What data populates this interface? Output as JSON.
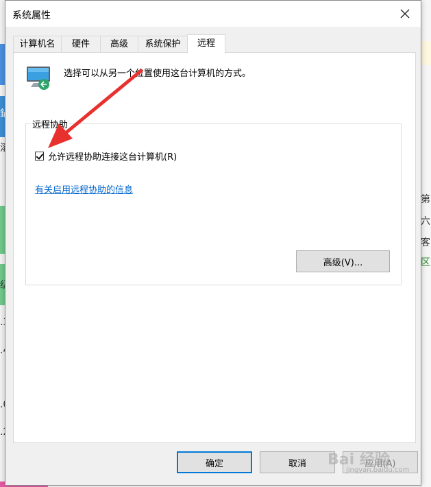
{
  "background": {
    "left_fragments": [
      "鍋",
      "滚",
      "级",
      ".3",
      ".4",
      ".0",
      ".2"
    ],
    "right_fragments": [
      "第",
      "六",
      "客",
      "区"
    ]
  },
  "dialog": {
    "title": "系统属性",
    "tabs": [
      {
        "label": "计算机名",
        "active": false
      },
      {
        "label": "硬件",
        "active": false
      },
      {
        "label": "高级",
        "active": false
      },
      {
        "label": "系统保护",
        "active": false
      },
      {
        "label": "远程",
        "active": true
      }
    ],
    "description": "选择可以从另一个位置使用这台计算机的方式。",
    "remote_assistance": {
      "group_label": "远程协助",
      "checkbox_label": "允许远程协助连接这台计算机(R)",
      "checkbox_checked": true,
      "link_text": "有关启用远程协助的信息",
      "advanced_button": "高级(V)..."
    },
    "buttons": {
      "ok": "确定",
      "cancel": "取消",
      "apply": "应用(A)"
    }
  },
  "annotation": {
    "arrow_color": "#e8312f"
  },
  "watermark": {
    "logo": "Bai 经验",
    "url": "jingyan.baidu.com"
  }
}
